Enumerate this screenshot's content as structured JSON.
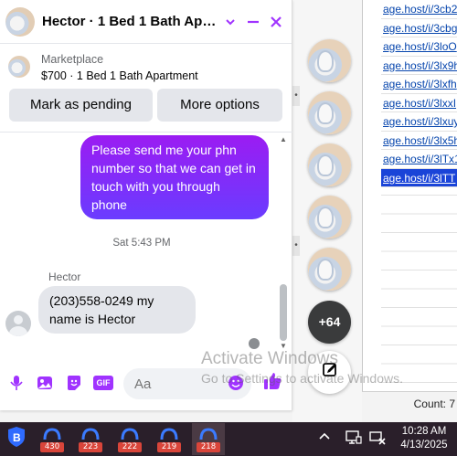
{
  "chat": {
    "title": "Hector · 1 Bed 1 Bath Apart…",
    "listing": {
      "source": "Marketplace",
      "title": "$700 · 1 Bed 1 Bath Apartment",
      "mark_pending": "Mark as pending",
      "more_options": "More options"
    },
    "messages": {
      "outgoing": "Please send me your phn number so that we can get in touch with you through phone",
      "timestamp": "Sat 5:43 PM",
      "sender_name": "Hector",
      "incoming": "(203)558-0249 my name is Hector"
    },
    "composer": {
      "placeholder": "Aa",
      "gif_label": "GIF"
    },
    "accent_color": "#a033ff"
  },
  "chat_heads": {
    "more_count": "+64"
  },
  "sheet": {
    "links": [
      "age.host/i/3cb2",
      "age.host/i/3cbg",
      "age.host/i/3loO",
      "age.host/i/3lx9h",
      "age.host/i/3lxfh",
      "age.host/i/3lxxI",
      "age.host/i/3lxuy",
      "age.host/i/3lx5h",
      "age.host/i/3lTx1",
      "age.host/i/3lTT"
    ],
    "status_count": "Count: 7"
  },
  "watermark": {
    "line1": "Activate Windows",
    "line2": "Go to Settings to activate Windows."
  },
  "taskbar": {
    "badges": [
      "430",
      "223",
      "222",
      "219",
      "218"
    ],
    "time": "10:28 AM",
    "date": "4/13/2025"
  }
}
